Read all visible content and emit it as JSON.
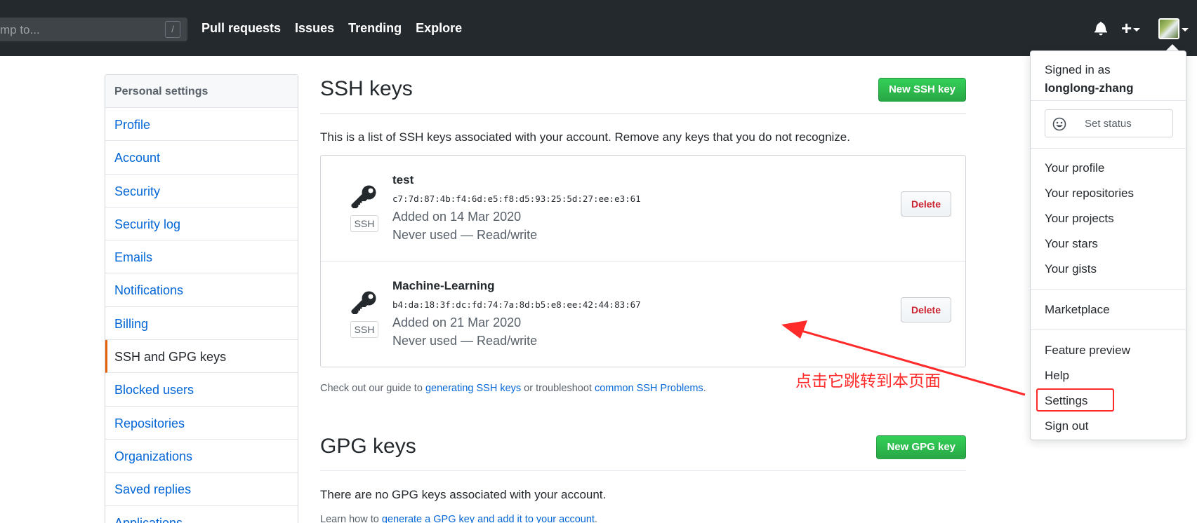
{
  "header": {
    "search_placeholder": "mp to...",
    "search_shortcut": "/",
    "nav": [
      "Pull requests",
      "Issues",
      "Trending",
      "Explore"
    ],
    "plus_label": "+"
  },
  "sidebar": {
    "heading": "Personal settings",
    "items": [
      {
        "label": "Profile"
      },
      {
        "label": "Account"
      },
      {
        "label": "Security"
      },
      {
        "label": "Security log"
      },
      {
        "label": "Emails"
      },
      {
        "label": "Notifications"
      },
      {
        "label": "Billing"
      },
      {
        "label": "SSH and GPG keys",
        "active": true
      },
      {
        "label": "Blocked users"
      },
      {
        "label": "Repositories"
      },
      {
        "label": "Organizations"
      },
      {
        "label": "Saved replies"
      },
      {
        "label": "Applications"
      }
    ]
  },
  "ssh": {
    "title": "SSH keys",
    "new_button": "New SSH key",
    "description": "This is a list of SSH keys associated with your account. Remove any keys that you do not recognize.",
    "keys": [
      {
        "name": "test",
        "fingerprint": "c7:7d:87:4b:f4:6d:e5:f8:d5:93:25:5d:27:ee:e3:61",
        "added": "Added on 14 Mar 2020",
        "usage": "Never used — Read/write",
        "type": "SSH",
        "delete_label": "Delete"
      },
      {
        "name": "Machine-Learning",
        "fingerprint": "b4:da:18:3f:dc:fd:74:7a:8d:b5:e8:ee:42:44:83:67",
        "added": "Added on 21 Mar 2020",
        "usage": "Never used — Read/write",
        "type": "SSH",
        "delete_label": "Delete"
      }
    ],
    "guide_prefix": "Check out our guide to ",
    "guide_link1": "generating SSH keys",
    "guide_middle": " or troubleshoot ",
    "guide_link2": "common SSH Problems",
    "guide_suffix": "."
  },
  "gpg": {
    "title": "GPG keys",
    "new_button": "New GPG key",
    "empty_text": "There are no GPG keys associated with your account.",
    "learn_prefix": "Learn how to ",
    "learn_link": "generate a GPG key and add it to your account",
    "learn_suffix": "."
  },
  "dropdown": {
    "signed_in_as": "Signed in as",
    "username": "longlong-zhang",
    "set_status": "Set status",
    "items": [
      "Your profile",
      "Your repositories",
      "Your projects",
      "Your stars",
      "Your gists",
      "Marketplace",
      "Feature preview",
      "Help",
      "Settings",
      "Sign out"
    ]
  },
  "annotation": {
    "text": "点击它跳转到本页面",
    "color": "#ff2a2a"
  },
  "colors": {
    "header_bg": "#24292e",
    "link": "#0366d6",
    "green_button": "#28a745",
    "danger": "#cb2431",
    "active_marker": "#e36209"
  }
}
